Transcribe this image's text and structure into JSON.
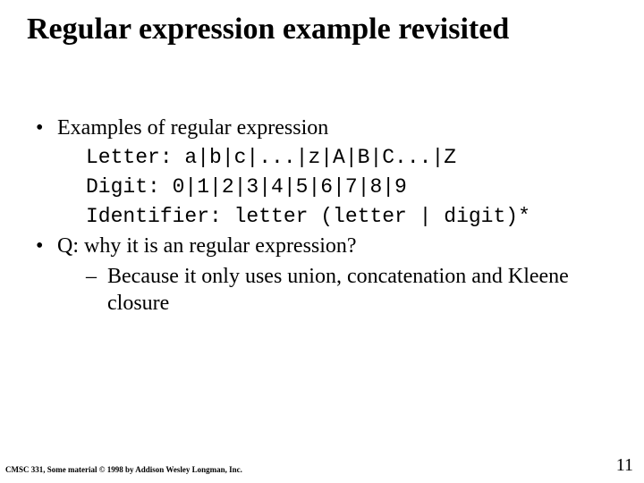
{
  "title": "Regular expression example  revisited",
  "bullet1": "Examples of regular expression",
  "code_line1": "Letter:  a|b|c|...|z|A|B|C...|Z",
  "code_line2": "Digit: 0|1|2|3|4|5|6|7|8|9",
  "code_line3": "Identifier: letter (letter | digit)*",
  "bullet2": "Q: why it is an regular expression?",
  "sub_bullet": "Because it only uses union, concatenation and Kleene closure",
  "footer_left": "CMSC 331, Some material © 1998 by Addison Wesley Longman, Inc.",
  "page_number": "11",
  "glyphs": {
    "dot": "•",
    "dash": "–"
  }
}
